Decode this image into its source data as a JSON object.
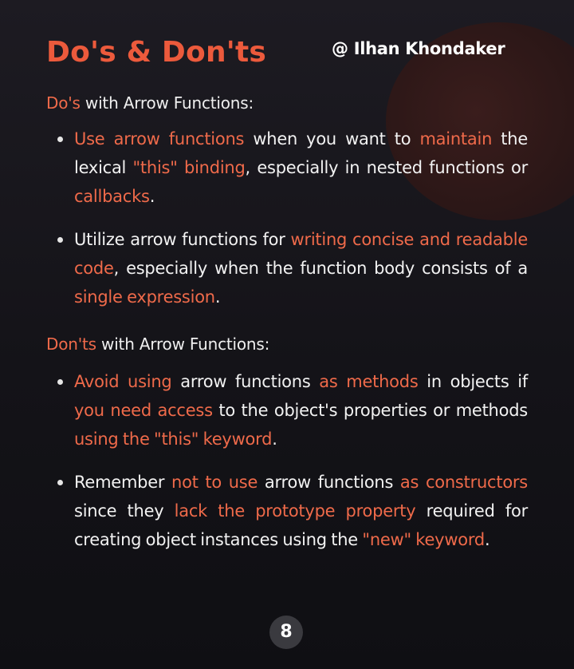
{
  "title": "Do's & Don'ts",
  "author": "@ Ilhan Khondaker",
  "dos": {
    "heading": {
      "highlight": "Do's",
      "rest": " with Arrow Functions:"
    },
    "items": [
      {
        "segments": [
          {
            "t": "Use arrow functions",
            "h": true
          },
          {
            "t": " when you want to "
          },
          {
            "t": "maintain",
            "h": true
          },
          {
            "t": " the lexical "
          },
          {
            "t": "\"this\" binding",
            "h": true
          },
          {
            "t": ", especially in nested functions or "
          },
          {
            "t": "callbacks",
            "h": true
          },
          {
            "t": "."
          }
        ]
      },
      {
        "segments": [
          {
            "t": "Utilize arrow functions for "
          },
          {
            "t": "writing concise and readable code",
            "h": true
          },
          {
            "t": ", especially when the function body consists of a "
          },
          {
            "t": "single expression",
            "h": true
          },
          {
            "t": "."
          }
        ]
      }
    ]
  },
  "donts": {
    "heading": {
      "highlight": "Don'ts",
      "rest": " with Arrow Functions:"
    },
    "items": [
      {
        "segments": [
          {
            "t": "Avoid using",
            "h": true
          },
          {
            "t": " arrow functions "
          },
          {
            "t": "as methods",
            "h": true
          },
          {
            "t": " in objects if "
          },
          {
            "t": "you need access",
            "h": true
          },
          {
            "t": " to the object's properties or methods "
          },
          {
            "t": "using the \"this\" keyword",
            "h": true
          },
          {
            "t": "."
          }
        ]
      },
      {
        "segments": [
          {
            "t": "Remember "
          },
          {
            "t": "not to use",
            "h": true
          },
          {
            "t": " arrow functions "
          },
          {
            "t": "as constructors",
            "h": true
          },
          {
            "t": " since they "
          },
          {
            "t": "lack the prototype property",
            "h": true
          },
          {
            "t": " required for creating object instances using the "
          },
          {
            "t": "\"new\" keyword",
            "h": true
          },
          {
            "t": "."
          }
        ]
      }
    ]
  },
  "page_number": "8",
  "colors": {
    "accent": "#ec5a3c",
    "highlight": "#ef6a4a",
    "text": "#f2f2f2",
    "background": "#16151a"
  }
}
